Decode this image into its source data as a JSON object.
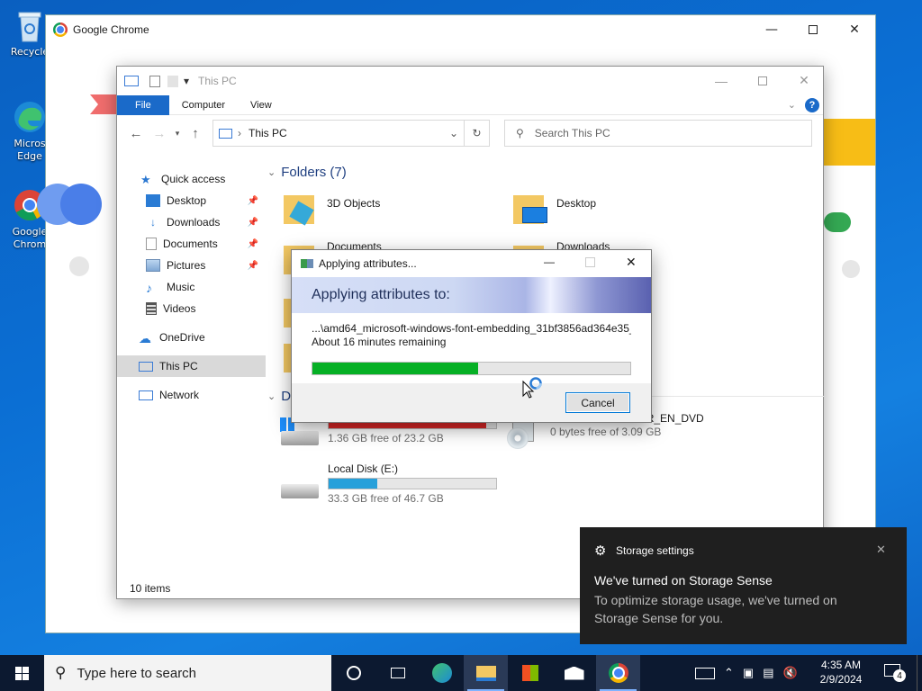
{
  "desktop": {
    "icons": [
      {
        "label": "Recycle"
      },
      {
        "label": "Micros Edge"
      },
      {
        "label": "Google Chrom"
      }
    ]
  },
  "chrome": {
    "title": "Google Chrome"
  },
  "explorer": {
    "title": "This PC",
    "tabs": [
      "File",
      "Computer",
      "View"
    ],
    "address": "This PC",
    "search_placeholder": "Search This PC",
    "nav": {
      "quick_access": "Quick access",
      "items": [
        "Desktop",
        "Downloads",
        "Documents",
        "Pictures",
        "Music",
        "Videos"
      ],
      "onedrive": "OneDrive",
      "thispc": "This PC",
      "network": "Network"
    },
    "folders_header": "Folders (7)",
    "folders": [
      "3D Objects",
      "Desktop",
      "Documents",
      "Downloads"
    ],
    "devices_header": "De",
    "drives": [
      {
        "name": "",
        "free": "1.36 GB free of 23.2 GB",
        "fill_fraction": 0.94,
        "color": "#da2626"
      },
      {
        "name": "GSP1RMCULXFRER_EN_DVD",
        "free": "0 bytes free of 3.09 GB"
      },
      {
        "name": "Local Disk (E:)",
        "free": "33.3 GB free of 46.7 GB",
        "fill_fraction": 0.29,
        "color": "#26a0da"
      }
    ],
    "status": "10 items"
  },
  "dialog": {
    "title": "Applying attributes...",
    "heading": "Applying attributes to:",
    "path": "...\\amd64_microsoft-windows-font-embedding_31bf3856ad364e35_",
    "remaining": "About 16 minutes remaining",
    "progress_fraction": 0.52,
    "cancel_label": "Cancel"
  },
  "toast": {
    "app": "Storage settings",
    "title": "We've turned on Storage Sense",
    "body": "To optimize storage usage, we've turned on Storage Sense for you."
  },
  "taskbar": {
    "search_placeholder": "Type here to search",
    "time": "4:35 AM",
    "date": "2/9/2024",
    "notification_count": "4"
  }
}
